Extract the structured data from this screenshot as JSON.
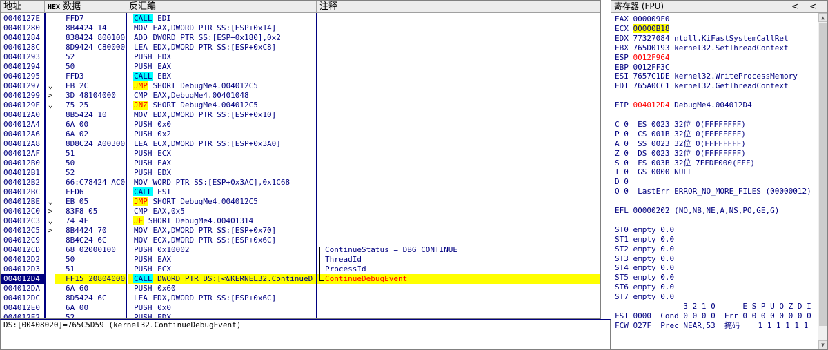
{
  "cpu": {
    "headers": {
      "addr": "地址",
      "hex_tag": "HEX",
      "hex": "数据",
      "asm": "反汇编",
      "comment": "注释"
    },
    "rows": [
      {
        "addr": "0040127E",
        "jmp": "",
        "hex": "FFD7",
        "mnem": "CALL",
        "mstyle": "call",
        "args": " EDI",
        "cmt": ""
      },
      {
        "addr": "00401280",
        "jmp": "",
        "hex": "8B4424 14",
        "mnem": "MOV",
        "mstyle": "plain",
        "args": " EAX,DWORD PTR SS:[ESP+0x14]",
        "cmt": ""
      },
      {
        "addr": "00401284",
        "jmp": "",
        "hex": "838424 800100",
        "mnem": "ADD",
        "mstyle": "plain",
        "args": " DWORD PTR SS:[ESP+0x180],0x2",
        "cmt": ""
      },
      {
        "addr": "0040128C",
        "jmp": "",
        "hex": "8D9424 C80000",
        "mnem": "LEA",
        "mstyle": "plain",
        "args": " EDX,DWORD PTR SS:[ESP+0xC8]",
        "cmt": ""
      },
      {
        "addr": "00401293",
        "jmp": "",
        "hex": "52",
        "mnem": "PUSH",
        "mstyle": "plain",
        "args": " EDX",
        "cmt": ""
      },
      {
        "addr": "00401294",
        "jmp": "",
        "hex": "50",
        "mnem": "PUSH",
        "mstyle": "plain",
        "args": " EAX",
        "cmt": ""
      },
      {
        "addr": "00401295",
        "jmp": "",
        "hex": "FFD3",
        "mnem": "CALL",
        "mstyle": "call",
        "args": " EBX",
        "cmt": ""
      },
      {
        "addr": "00401297",
        "jmp": "⌄",
        "hex": "EB 2C",
        "mnem": "JMP",
        "mstyle": "jmp",
        "args": " SHORT DebugMe4.004012C5",
        "cmt": ""
      },
      {
        "addr": "00401299",
        "jmp": ">",
        "hex": "3D 48104000",
        "mnem": "CMP",
        "mstyle": "plain",
        "args": " EAX,DebugMe4.00401048",
        "cmt": ""
      },
      {
        "addr": "0040129E",
        "jmp": "⌄",
        "hex": "75 25",
        "mnem": "JNZ",
        "mstyle": "jmp",
        "args": " SHORT DebugMe4.004012C5",
        "cmt": ""
      },
      {
        "addr": "004012A0",
        "jmp": "",
        "hex": "8B5424 10",
        "mnem": "MOV",
        "mstyle": "plain",
        "args": " EDX,DWORD PTR SS:[ESP+0x10]",
        "cmt": ""
      },
      {
        "addr": "004012A4",
        "jmp": "",
        "hex": "6A 00",
        "mnem": "PUSH",
        "mstyle": "plain",
        "args": " 0x0",
        "cmt": ""
      },
      {
        "addr": "004012A6",
        "jmp": "",
        "hex": "6A 02",
        "mnem": "PUSH",
        "mstyle": "plain",
        "args": " 0x2",
        "cmt": ""
      },
      {
        "addr": "004012A8",
        "jmp": "",
        "hex": "8D8C24 A00300",
        "mnem": "LEA",
        "mstyle": "plain",
        "args": " ECX,DWORD PTR SS:[ESP+0x3A0]",
        "cmt": ""
      },
      {
        "addr": "004012AF",
        "jmp": "",
        "hex": "51",
        "mnem": "PUSH",
        "mstyle": "plain",
        "args": " ECX",
        "cmt": ""
      },
      {
        "addr": "004012B0",
        "jmp": "",
        "hex": "50",
        "mnem": "PUSH",
        "mstyle": "plain",
        "args": " EAX",
        "cmt": ""
      },
      {
        "addr": "004012B1",
        "jmp": "",
        "hex": "52",
        "mnem": "PUSH",
        "mstyle": "plain",
        "args": " EDX",
        "cmt": ""
      },
      {
        "addr": "004012B2",
        "jmp": "",
        "hex": "66:C78424 AC0",
        "mnem": "MOV",
        "mstyle": "plain",
        "args": " WORD PTR SS:[ESP+0x3AC],0x1C68",
        "cmt": ""
      },
      {
        "addr": "004012BC",
        "jmp": "",
        "hex": "FFD6",
        "mnem": "CALL",
        "mstyle": "call",
        "args": " ESI",
        "cmt": ""
      },
      {
        "addr": "004012BE",
        "jmp": "⌄",
        "hex": "EB 05",
        "mnem": "JMP",
        "mstyle": "jmp",
        "args": " SHORT DebugMe4.004012C5",
        "cmt": ""
      },
      {
        "addr": "004012C0",
        "jmp": ">",
        "hex": "83F8 05",
        "mnem": "CMP",
        "mstyle": "plain",
        "args": " EAX,0x5",
        "cmt": ""
      },
      {
        "addr": "004012C3",
        "jmp": "⌄",
        "hex": "74 4F",
        "mnem": "JE",
        "mstyle": "jmp",
        "args": " SHORT DebugMe4.00401314",
        "cmt": ""
      },
      {
        "addr": "004012C5",
        "jmp": ">",
        "hex": "8B4424 70",
        "mnem": "MOV",
        "mstyle": "plain",
        "args": " EAX,DWORD PTR SS:[ESP+0x70]",
        "cmt": ""
      },
      {
        "addr": "004012C9",
        "jmp": "",
        "hex": "8B4C24 6C",
        "mnem": "MOV",
        "mstyle": "plain",
        "args": " ECX,DWORD PTR SS:[ESP+0x6C]",
        "cmt": ""
      },
      {
        "addr": "004012CD",
        "jmp": "",
        "hex": "68 02000100",
        "mnem": "PUSH",
        "mstyle": "plain",
        "args": " 0x10002",
        "cmt": "ContinueStatus = DBG_CONTINUE"
      },
      {
        "addr": "004012D2",
        "jmp": "",
        "hex": "50",
        "mnem": "PUSH",
        "mstyle": "plain",
        "args": " EAX",
        "cmt": "ThreadId"
      },
      {
        "addr": "004012D3",
        "jmp": "",
        "hex": "51",
        "mnem": "PUSH",
        "mstyle": "plain",
        "args": " ECX",
        "cmt": "ProcessId"
      },
      {
        "addr": "004012D4",
        "jmp": "",
        "hex": "FF15 20804000",
        "mnem": "CALL",
        "mstyle": "call",
        "args": " DWORD PTR DS:[<&KERNEL32.ContinueD",
        "cmt": "ContinueDebugEvent",
        "sel": true,
        "cmt_red": true
      },
      {
        "addr": "004012DA",
        "jmp": "",
        "hex": "6A 60",
        "mnem": "PUSH",
        "mstyle": "plain",
        "args": " 0x60",
        "cmt": ""
      },
      {
        "addr": "004012DC",
        "jmp": "",
        "hex": "8D5424 6C",
        "mnem": "LEA",
        "mstyle": "plain",
        "args": " EDX,DWORD PTR SS:[ESP+0x6C]",
        "cmt": ""
      },
      {
        "addr": "004012E0",
        "jmp": "",
        "hex": "6A 00",
        "mnem": "PUSH",
        "mstyle": "plain",
        "args": " 0x0",
        "cmt": ""
      },
      {
        "addr": "004012E2",
        "jmp": "",
        "hex": "52",
        "mnem": "PUSH",
        "mstyle": "plain",
        "args": " EDX",
        "cmt": ""
      }
    ]
  },
  "info": {
    "text": "DS:[00408020]=765C5D59 (kernel32.ContinueDebugEvent)"
  },
  "registers": {
    "title": "寄存器 (FPU)",
    "btn_left": "<",
    "btn_right": "<",
    "lines": [
      [
        {
          "t": "EAX "
        },
        {
          "t": "000009F0"
        }
      ],
      [
        {
          "t": "ECX "
        },
        {
          "t": "00000B18",
          "c": "hl"
        }
      ],
      [
        {
          "t": "EDX "
        },
        {
          "t": "77327084"
        },
        {
          "t": " ntdll.KiFastSystemCallRet"
        }
      ],
      [
        {
          "t": "EBX "
        },
        {
          "t": "765D0193"
        },
        {
          "t": " kernel32.SetThreadContext"
        }
      ],
      [
        {
          "t": "ESP "
        },
        {
          "t": "0012F964",
          "c": "red"
        }
      ],
      [
        {
          "t": "EBP "
        },
        {
          "t": "0012FF3C"
        }
      ],
      [
        {
          "t": "ESI "
        },
        {
          "t": "7657C1DE"
        },
        {
          "t": " kernel32.WriteProcessMemory"
        }
      ],
      [
        {
          "t": "EDI "
        },
        {
          "t": "765A0CC1"
        },
        {
          "t": " kernel32.GetThreadContext"
        }
      ],
      [],
      [
        {
          "t": "EIP "
        },
        {
          "t": "004012D4",
          "c": "red"
        },
        {
          "t": " DebugMe4.004012D4"
        }
      ],
      [],
      [
        {
          "t": "C 0  ES 0023 32"
        },
        {
          "t": "位",
          "c": "cjk"
        },
        {
          "t": " 0(FFFFFFFF)"
        }
      ],
      [
        {
          "t": "P 0  CS 001B 32"
        },
        {
          "t": "位",
          "c": "cjk"
        },
        {
          "t": " 0(FFFFFFFF)"
        }
      ],
      [
        {
          "t": "A 0  SS 0023 32"
        },
        {
          "t": "位",
          "c": "cjk"
        },
        {
          "t": " 0(FFFFFFFF)"
        }
      ],
      [
        {
          "t": "Z 0  DS 0023 32"
        },
        {
          "t": "位",
          "c": "cjk"
        },
        {
          "t": " 0(FFFFFFFF)"
        }
      ],
      [
        {
          "t": "S 0  FS 003B 32"
        },
        {
          "t": "位",
          "c": "cjk"
        },
        {
          "t": " 7FFDE000(FFF)"
        }
      ],
      [
        {
          "t": "T 0  GS 0000 NULL"
        }
      ],
      [
        {
          "t": "D 0"
        }
      ],
      [
        {
          "t": "O 0  LastErr ERROR_NO_MORE_FILES (00000012)"
        }
      ],
      [],
      [
        {
          "t": "EFL 00000202 (NO,NB,NE,A,NS,PO,GE,G)"
        }
      ],
      [],
      [
        {
          "t": "ST0 empty 0.0"
        }
      ],
      [
        {
          "t": "ST1 empty 0.0"
        }
      ],
      [
        {
          "t": "ST2 empty 0.0"
        }
      ],
      [
        {
          "t": "ST3 empty 0.0"
        }
      ],
      [
        {
          "t": "ST4 empty 0.0"
        }
      ],
      [
        {
          "t": "ST5 empty 0.0"
        }
      ],
      [
        {
          "t": "ST6 empty 0.0"
        }
      ],
      [
        {
          "t": "ST7 empty 0.0"
        }
      ],
      [
        {
          "t": "               3 2 1 0      E S P U O Z D I"
        }
      ],
      [
        {
          "t": "FST 0000  Cond 0 0 0 0  Err 0 0 0 0 0 0 0 0"
        }
      ],
      [
        {
          "t": "FCW 027F  Prec NEAR,53  "
        },
        {
          "t": "掩码",
          "c": "cjk"
        },
        {
          "t": "    1 1 1 1 1 1"
        }
      ]
    ]
  },
  "colors": {
    "selection_addr_bg": "#000080",
    "selection_bg": "#ffff00",
    "call_bg": "#00ffff",
    "jump_fg": "#ff0000",
    "text": "#000080"
  }
}
